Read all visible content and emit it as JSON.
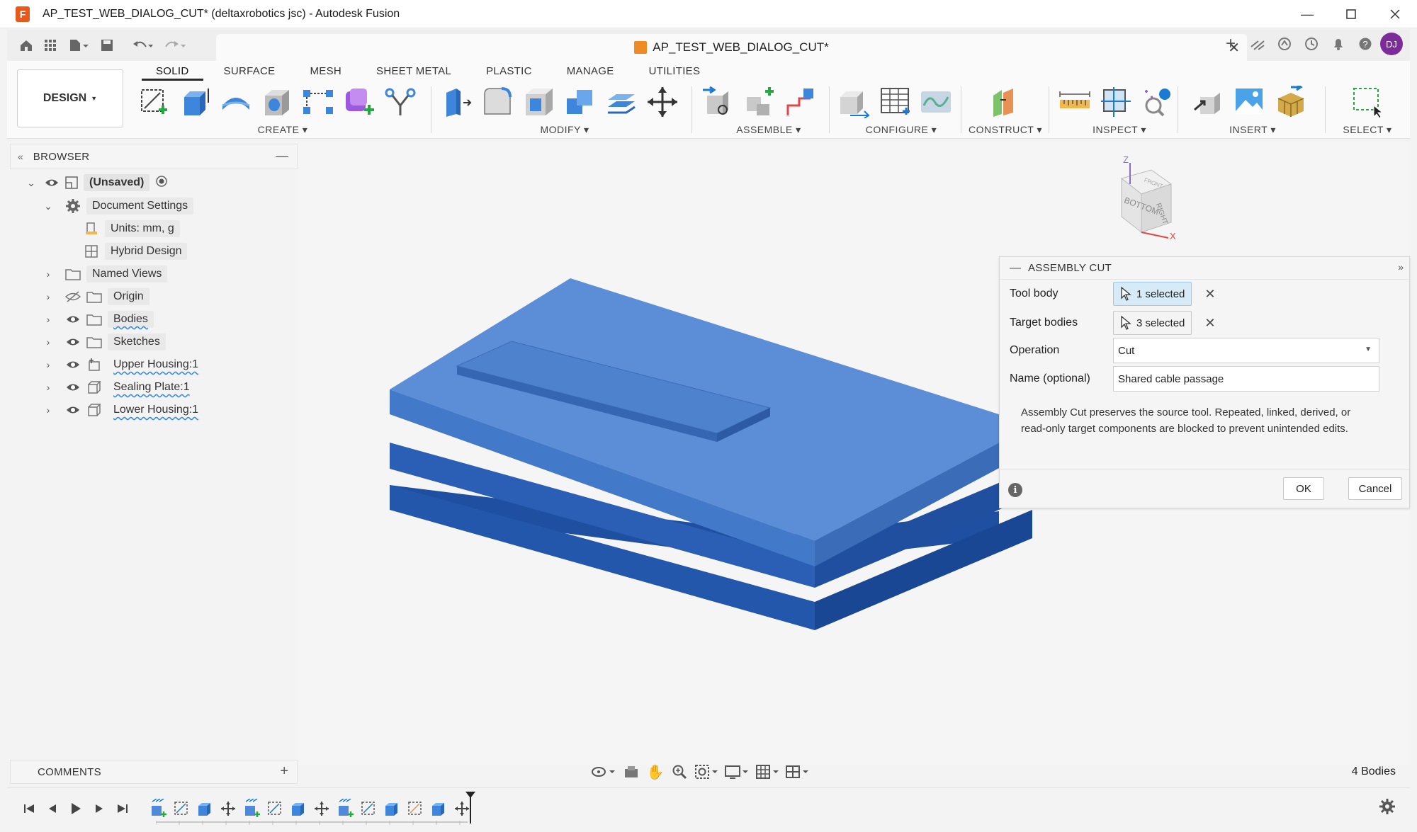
{
  "window": {
    "title": "AP_TEST_WEB_DIALOG_CUT* (deltaxrobotics jsc) - Autodesk Fusion",
    "app_icon_letter": "F"
  },
  "document_tab": {
    "title": "AP_TEST_WEB_DIALOG_CUT*"
  },
  "user": {
    "initials": "DJ",
    "avatar_color": "#7b2b9a"
  },
  "workspace": {
    "label": "DESIGN"
  },
  "ribbon": {
    "tabs": [
      "SOLID",
      "SURFACE",
      "MESH",
      "SHEET METAL",
      "PLASTIC",
      "MANAGE",
      "UTILITIES"
    ],
    "active_tab": "SOLID",
    "groups": {
      "create": "CREATE",
      "modify": "MODIFY",
      "assemble": "ASSEMBLE",
      "configure": "CONFIGURE",
      "construct": "CONSTRUCT",
      "inspect": "INSPECT",
      "insert": "INSERT",
      "select": "SELECT"
    }
  },
  "browser": {
    "title": "BROWSER",
    "root": "(Unsaved)",
    "items": {
      "document_settings": "Document Settings",
      "units": "Units: mm, g",
      "hybrid_design": "Hybrid Design",
      "named_views": "Named Views",
      "origin": "Origin",
      "bodies": "Bodies",
      "sketches": "Sketches",
      "upper_housing": "Upper Housing:1",
      "sealing_plate": "Sealing Plate:1",
      "lower_housing": "Lower Housing:1"
    }
  },
  "viewcube": {
    "faces": [
      "BOTTOM",
      "RIGHT",
      "FRONT"
    ],
    "axis_z": "Z",
    "axis_x": "X"
  },
  "dialog": {
    "title": "ASSEMBLY CUT",
    "tool_body_label": "Tool body",
    "tool_body_value": "1 selected",
    "target_bodies_label": "Target bodies",
    "target_bodies_value": "3 selected",
    "operation_label": "Operation",
    "operation_value": "Cut",
    "name_label": "Name (optional)",
    "name_value": "Shared cable passage",
    "note": "Assembly Cut preserves the source tool. Repeated, linked, derived, or read-only target components are blocked to prevent unintended edits.",
    "ok_label": "OK",
    "cancel_label": "Cancel"
  },
  "comments": {
    "title": "COMMENTS"
  },
  "status": {
    "bodies_count": "4 Bodies"
  },
  "colors": {
    "body_top": "#5b8ed6",
    "body_side": "#2f64b8",
    "body_dark": "#1e4fa0",
    "accent_blue": "#1a7ad4",
    "selection_bg": "#d6eaf7"
  }
}
